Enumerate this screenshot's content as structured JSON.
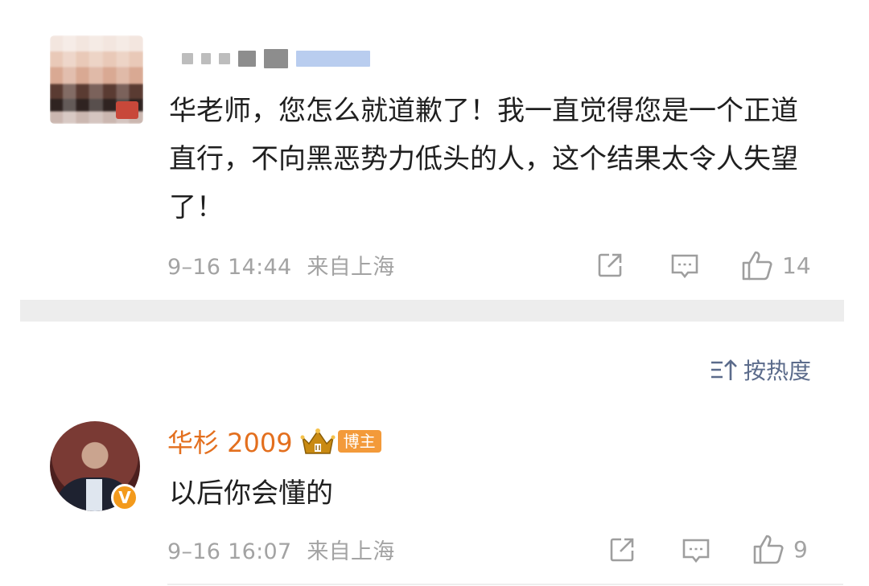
{
  "comments": [
    {
      "text": "华老师，您怎么就道歉了！我一直觉得您是一个正道直行，不向黑恶势力低头的人，这个结果太令人失望了！",
      "time": "9–16 14:44",
      "location": "来自上海",
      "likes": "14"
    },
    {
      "username": "华杉 2009",
      "tag": "博主",
      "text": "以后你会懂的",
      "time": "9–16 16:07",
      "location": "来自上海",
      "likes": "9",
      "verified_badge": "V"
    }
  ],
  "sort": {
    "label": "按热度",
    "icon": "sort-icon"
  },
  "colors": {
    "username_orange": "#e36f1e",
    "sort_blue": "#5b6b8b",
    "meta_gray": "#a3a3a3",
    "tag_orange": "#f39a3a",
    "band_gray": "#ededed"
  }
}
